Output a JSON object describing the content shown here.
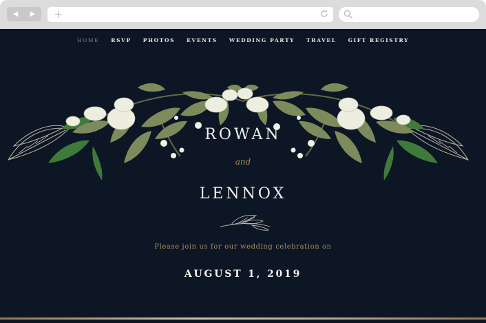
{
  "browser": {
    "back_icon": "back-arrow-icon",
    "forward_icon": "forward-arrow-icon",
    "new_tab_icon": "plus-icon",
    "reload_icon": "reload-icon",
    "search_icon": "search-icon",
    "back_glyph": "◀",
    "forward_glyph": "▶",
    "plus_glyph": "+"
  },
  "nav": {
    "items": [
      {
        "label": "HOME",
        "active": true
      },
      {
        "label": "RSVP"
      },
      {
        "label": "PHOTOS"
      },
      {
        "label": "EVENTS"
      },
      {
        "label": "WEDDING PARTY"
      },
      {
        "label": "TRAVEL"
      },
      {
        "label": "GIFT REGISTRY"
      }
    ]
  },
  "hero": {
    "name_one": "ROWAN",
    "connector": "and",
    "name_two": "LENNOX",
    "invitation": "Please join us for our wedding celebration on",
    "date": "AUGUST 1, 2019"
  },
  "colors": {
    "background": "#0c1624",
    "accent_gold": "#a68d5e",
    "text_light": "#f5f3ee",
    "leaf_green": "#7d8b5c"
  }
}
